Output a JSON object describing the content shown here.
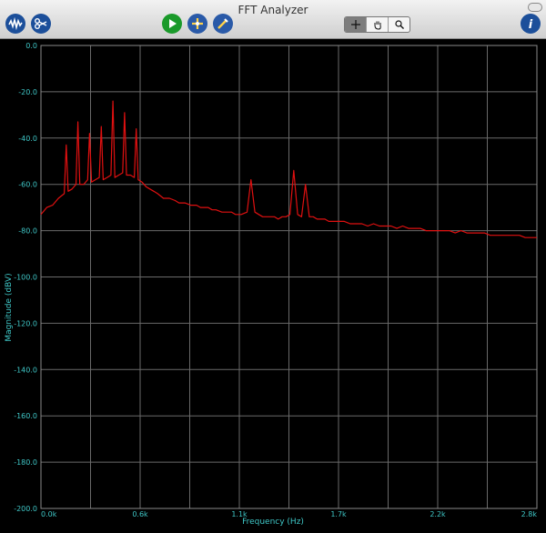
{
  "window": {
    "title": "FFT Analyzer"
  },
  "toolbar": {
    "left_icons": [
      "waveform-icon",
      "scissors-icon"
    ],
    "center_icons": [
      "play-icon",
      "add-marker-icon",
      "clear-marker-icon"
    ],
    "tools": [
      "crosshair-icon",
      "hand-icon",
      "zoom-icon"
    ],
    "info_icon": "info-icon"
  },
  "colors": {
    "trace": "#e01010",
    "grid": "#6a6a6a",
    "label": "#3fc7c7",
    "background": "#000000"
  },
  "chart_data": {
    "type": "line",
    "title": "",
    "xlabel": "Frequency (Hz)",
    "ylabel": "Magnitude (dBV)",
    "xlim": [
      0,
      2.55
    ],
    "ylim": [
      -200,
      0
    ],
    "x_ticks": [
      {
        "v": 0.0,
        "label": "0.0k"
      },
      {
        "v": 0.51,
        "label": "0.6k"
      },
      {
        "v": 1.02,
        "label": "1.1k"
      },
      {
        "v": 1.53,
        "label": "1.7k"
      },
      {
        "v": 2.04,
        "label": "2.2k"
      },
      {
        "v": 2.55,
        "label": "2.8k"
      }
    ],
    "y_ticks": [
      {
        "v": 0,
        "label": "0.0"
      },
      {
        "v": -20,
        "label": "-20.0"
      },
      {
        "v": -40,
        "label": "-40.0"
      },
      {
        "v": -60,
        "label": "-60.0"
      },
      {
        "v": -80,
        "label": "-80.0"
      },
      {
        "v": -100,
        "label": "-100.0"
      },
      {
        "v": -120,
        "label": "-120.0"
      },
      {
        "v": -140,
        "label": "-140.0"
      },
      {
        "v": -160,
        "label": "-160.0"
      },
      {
        "v": -180,
        "label": "-180.0"
      },
      {
        "v": -200,
        "label": "-200.0"
      }
    ],
    "grid": true,
    "series": [
      {
        "x": [
          0.0,
          0.03,
          0.06,
          0.09,
          0.12,
          0.13,
          0.14,
          0.16,
          0.18,
          0.19,
          0.2,
          0.22,
          0.24,
          0.25,
          0.26,
          0.28,
          0.3,
          0.31,
          0.32,
          0.34,
          0.36,
          0.37,
          0.38,
          0.4,
          0.42,
          0.43,
          0.44,
          0.46,
          0.48,
          0.49,
          0.5,
          0.52,
          0.54,
          0.56,
          0.58,
          0.6,
          0.63,
          0.66,
          0.69,
          0.71,
          0.74,
          0.77,
          0.8,
          0.82,
          0.84,
          0.86,
          0.88,
          0.9,
          0.93,
          0.96,
          0.98,
          1.0,
          1.03,
          1.06,
          1.08,
          1.1,
          1.12,
          1.14,
          1.17,
          1.2,
          1.22,
          1.24,
          1.26,
          1.28,
          1.3,
          1.32,
          1.34,
          1.36,
          1.38,
          1.4,
          1.42,
          1.44,
          1.46,
          1.48,
          1.5,
          1.53,
          1.56,
          1.59,
          1.62,
          1.65,
          1.68,
          1.71,
          1.74,
          1.77,
          1.8,
          1.83,
          1.86,
          1.89,
          1.92,
          1.95,
          1.98,
          2.01,
          2.04,
          2.07,
          2.1,
          2.13,
          2.16,
          2.19,
          2.22,
          2.25,
          2.28,
          2.31,
          2.34,
          2.37,
          2.4,
          2.43,
          2.46,
          2.49,
          2.52,
          2.55
        ],
        "y": [
          -73,
          -70,
          -69,
          -66,
          -64,
          -43,
          -63,
          -62,
          -60,
          -33,
          -60,
          -60,
          -58,
          -38,
          -59,
          -58,
          -57,
          -35,
          -58,
          -57,
          -56,
          -24,
          -57,
          -56,
          -55,
          -29,
          -56,
          -56,
          -57,
          -36,
          -58,
          -59,
          -61,
          -62,
          -63,
          -64,
          -66,
          -66,
          -67,
          -68,
          -68,
          -69,
          -69,
          -70,
          -70,
          -70,
          -71,
          -71,
          -72,
          -72,
          -72,
          -73,
          -73,
          -72,
          -58,
          -72,
          -73,
          -74,
          -74,
          -74,
          -75,
          -74,
          -74,
          -73,
          -54,
          -73,
          -74,
          -60,
          -74,
          -74,
          -75,
          -75,
          -75,
          -76,
          -76,
          -76,
          -76,
          -77,
          -77,
          -77,
          -78,
          -77,
          -78,
          -78,
          -78,
          -79,
          -78,
          -79,
          -79,
          -79,
          -80,
          -80,
          -80,
          -80,
          -80,
          -81,
          -80,
          -81,
          -81,
          -81,
          -81,
          -82,
          -82,
          -82,
          -82,
          -82,
          -82,
          -83,
          -83,
          -83
        ]
      }
    ]
  }
}
